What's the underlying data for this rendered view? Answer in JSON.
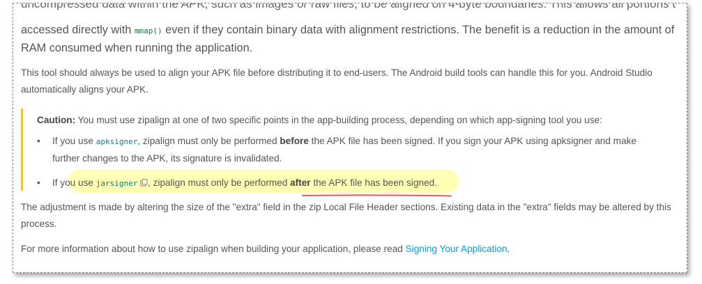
{
  "top_cut_text": "uncompressed data within the APK, such as images or raw files, to be aligned on 4-byte boundaries. This allows all portions to be",
  "lead": {
    "before_code": "accessed directly with ",
    "code": "mmap()",
    "after_code": " even if they contain binary data with alignment restrictions. The benefit is a reduction in the amount of RAM consumed when running the application."
  },
  "para1": "This tool should always be used to align your APK file before distributing it to end-users. The Android build tools can handle this for you. Android Studio automatically aligns your APK.",
  "caution": {
    "label": "Caution:",
    "text": " You must use zipalign at one of two specific points in the app-building process, depending on which app-signing tool you use:",
    "bullet_char": "•",
    "bullet1": {
      "pre": "If you use ",
      "code": "apksigner",
      "mid": ", zipalign must only be performed ",
      "bold": "before",
      "post": " the APK file has been signed. If you sign your APK using apksigner and make further changes to the APK, its signature is invalidated."
    },
    "bullet2": {
      "pre": "If you use ",
      "code": "jarsigner",
      "mid": ", zipalign must only be performed ",
      "bold": "after",
      "post": " the APK file has been signed."
    }
  },
  "para3": "The adjustment is made by altering the size of the \"extra\" field in the zip Local File Header sections. Existing data in the \"extra\" fields may be altered by this process.",
  "para4": {
    "pre": "For more information about how to use zipalign when building your application, please read ",
    "link": "Signing Your Application",
    "post": "."
  },
  "colors": {
    "caution_bar": "#f2c231",
    "highlight": "#ffff78",
    "underline": "#e05a5a",
    "link": "#039be5",
    "code_green": "#188038"
  },
  "icons": {
    "external_link": "external-link-icon"
  }
}
